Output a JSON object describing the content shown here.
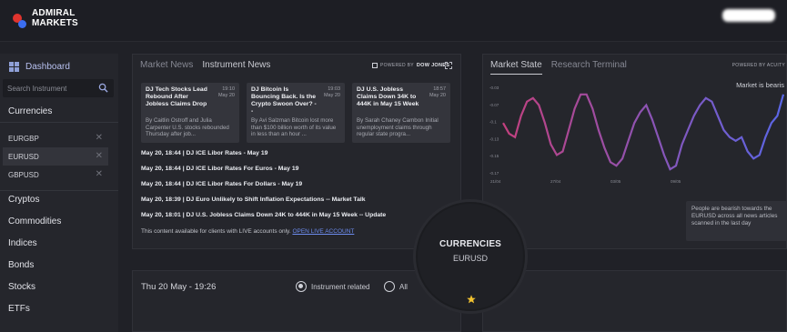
{
  "brand": {
    "line1": "ADMIRAL",
    "line2": "MARKETS"
  },
  "sidebar": {
    "dashboard_label": "Dashboard",
    "search_placeholder": "Search Instrument",
    "section_title": "Currencies",
    "currencies": [
      "EURGBP",
      "EURUSD",
      "GBPUSD"
    ],
    "active_currency": "EURUSD",
    "nav": [
      "Cryptos",
      "Commodities",
      "Indices",
      "Bonds",
      "Stocks",
      "ETFs"
    ]
  },
  "news": {
    "tabs": [
      "Market News",
      "Instrument News"
    ],
    "active_tab": "Instrument News",
    "powered_prefix": "POWERED BY",
    "powered_brand": "DOW JONES",
    "cards": [
      {
        "title": "DJ Tech Stocks Lead Rebound After Jobless Claims Drop",
        "time": "19:10",
        "date": "May 20",
        "body": "By Caitlin Ostroff and Julia Carpenter U.S. stocks rebounded Thursday after job..."
      },
      {
        "title": "DJ Bitcoin Is Bouncing Back. Is the Crypto Swoon Over? --",
        "time": "19:03",
        "date": "May 20",
        "body": "By Avi Salzman Bitcoin lost more than $100 billion worth of its value in less than an hour ..."
      },
      {
        "title": "DJ U.S. Jobless Claims Down 34K to 444K in May 15 Week",
        "time": "18:57",
        "date": "May 20",
        "body": "By Sarah Chaney Cambon Initial unemployment claims through regular state progra..."
      }
    ],
    "headlines": [
      "May 20, 18:44 | DJ ICE Libor Rates - May 19",
      "May 20, 18:44 | DJ ICE Libor Rates For Euros - May 19",
      "May 20, 18:44 | DJ ICE Libor Rates For Dollars - May 19",
      "May 20, 18:39 | DJ Euro Unlikely to Shift Inflation Expectations -- Market Talk",
      "May 20, 18:01 | DJ U.S. Jobless Claims Down 24K to 444K in May 15 Week -- Update"
    ],
    "live_note": "This content available for clients with LIVE accounts only.",
    "live_link": "OPEN LIVE ACCOUNT"
  },
  "market": {
    "tabs": [
      "Market State",
      "Research Terminal"
    ],
    "active_tab": "Market State",
    "powered_text": "POWERED BY ACUITY",
    "state_label": "Market is bearis",
    "bearish_text": "People are bearish towards the EURUSD across all news articles scanned in the last day",
    "chart_colors": {
      "start": "#c2407e",
      "end": "#5a66e6"
    }
  },
  "chart_data": {
    "type": "line",
    "y_ticks": [
      "-0.03",
      "-0.07",
      "-0.1",
      "-0.13",
      "-0.15",
      "-0.17"
    ],
    "x_ticks": [
      "21/04",
      "27/04",
      "03/05",
      "09/05"
    ],
    "values": [
      -0.11,
      -0.125,
      -0.13,
      -0.1,
      -0.08,
      -0.075,
      -0.085,
      -0.11,
      -0.14,
      -0.155,
      -0.15,
      -0.12,
      -0.09,
      -0.07,
      -0.07,
      -0.09,
      -0.12,
      -0.145,
      -0.165,
      -0.17,
      -0.16,
      -0.135,
      -0.11,
      -0.095,
      -0.085,
      -0.105,
      -0.13,
      -0.155,
      -0.175,
      -0.17,
      -0.14,
      -0.12,
      -0.1,
      -0.085,
      -0.075,
      -0.08,
      -0.1,
      -0.12,
      -0.13,
      -0.135,
      -0.13,
      -0.15,
      -0.16,
      -0.155,
      -0.13,
      -0.11,
      -0.1,
      -0.07
    ]
  },
  "timeline": {
    "datetime": "Thu 20 May - 19:26",
    "filter_options": [
      "Instrument related",
      "All"
    ],
    "selected": "Instrument related"
  },
  "center": {
    "title": "CURRENCIES",
    "instrument": "EURUSD",
    "star_color": "#f2c230"
  }
}
